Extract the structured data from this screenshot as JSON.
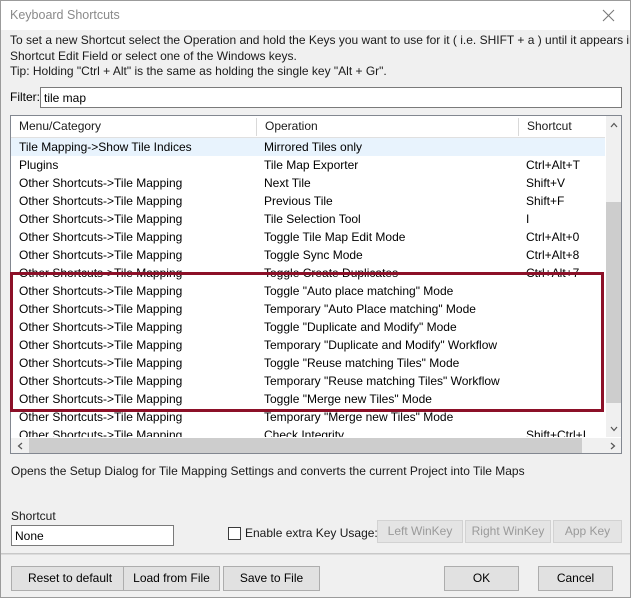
{
  "window": {
    "title": "Keyboard Shortcuts",
    "close_icon": "close-icon"
  },
  "instructions": [
    "To set a new Shortcut select the Operation and hold the Keys you want to use for it ( i.e. SHIFT + a ) until it appears in the",
    "Shortcut Edit Field or select one of the Windows keys.",
    "Tip: Holding \"Ctrl + Alt\" is the same as holding the single key \"Alt + Gr\"."
  ],
  "filter": {
    "label": "Filter:",
    "value": "tile map",
    "placeholder": ""
  },
  "list": {
    "columns": [
      "Menu/Category",
      "Operation",
      "Shortcut"
    ],
    "rows": [
      {
        "menu": "Tile Mapping->Show Tile Indices",
        "operation": "Mirrored Tiles only",
        "shortcut": ""
      },
      {
        "menu": "Plugins",
        "operation": "Tile Map Exporter",
        "shortcut": "Ctrl+Alt+T"
      },
      {
        "menu": "Other Shortcuts->Tile Mapping",
        "operation": "Next Tile",
        "shortcut": "Shift+V"
      },
      {
        "menu": "Other Shortcuts->Tile Mapping",
        "operation": "Previous Tile",
        "shortcut": "Shift+F"
      },
      {
        "menu": "Other Shortcuts->Tile Mapping",
        "operation": "Tile Selection Tool",
        "shortcut": "I"
      },
      {
        "menu": "Other Shortcuts->Tile Mapping",
        "operation": "Toggle Tile Map Edit Mode",
        "shortcut": "Ctrl+Alt+0"
      },
      {
        "menu": "Other Shortcuts->Tile Mapping",
        "operation": "Toggle Sync Mode",
        "shortcut": "Ctrl+Alt+8"
      },
      {
        "menu": "Other Shortcuts->Tile Mapping",
        "operation": "Toggle Create Duplicates",
        "shortcut": "Ctrl+Alt+7"
      },
      {
        "menu": "Other Shortcuts->Tile Mapping",
        "operation": "Toggle \"Auto place matching\" Mode",
        "shortcut": ""
      },
      {
        "menu": "Other Shortcuts->Tile Mapping",
        "operation": "Temporary \"Auto Place matching\" Mode",
        "shortcut": ""
      },
      {
        "menu": "Other Shortcuts->Tile Mapping",
        "operation": "Toggle \"Duplicate and Modify\" Mode",
        "shortcut": ""
      },
      {
        "menu": "Other Shortcuts->Tile Mapping",
        "operation": "Temporary \"Duplicate and Modify\" Workflow",
        "shortcut": ""
      },
      {
        "menu": "Other Shortcuts->Tile Mapping",
        "operation": "Toggle \"Reuse matching Tiles\" Mode",
        "shortcut": ""
      },
      {
        "menu": "Other Shortcuts->Tile Mapping",
        "operation": "Temporary \"Reuse matching Tiles\" Workflow",
        "shortcut": ""
      },
      {
        "menu": "Other Shortcuts->Tile Mapping",
        "operation": "Toggle \"Merge new Tiles\" Mode",
        "shortcut": ""
      },
      {
        "menu": "Other Shortcuts->Tile Mapping",
        "operation": "Temporary \"Merge new Tiles\" Mode",
        "shortcut": ""
      },
      {
        "menu": "Other Shortcuts->Tile Mapping",
        "operation": "Check Integrity",
        "shortcut": "Shift+Ctrl+I"
      }
    ],
    "selected_index": 0
  },
  "annotation": {
    "color": "#8c1028",
    "first_row_index": 8,
    "last_row_index": 15
  },
  "description": "Opens the Setup Dialog for Tile Mapping Settings and converts the current Project into Tile Maps",
  "shortcut_section": {
    "label": "Shortcut",
    "value": "None",
    "enable_extra_key_label": "Enable extra Key Usage:",
    "enable_extra_key_checked": false,
    "buttons": [
      {
        "label": "Left WinKey",
        "enabled": false
      },
      {
        "label": "Right WinKey",
        "enabled": false
      },
      {
        "label": "App Key",
        "enabled": false
      }
    ]
  },
  "footer": {
    "reset_label": "Reset to default",
    "load_label": "Load from File",
    "save_label": "Save to File",
    "ok_label": "OK",
    "cancel_label": "Cancel"
  }
}
